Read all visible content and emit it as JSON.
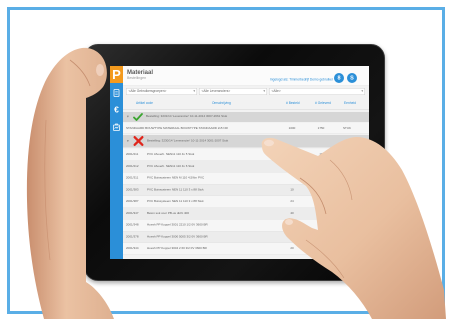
{
  "window": {
    "logo": "P",
    "title": "Materiaal",
    "subtitle": "Bestellingen",
    "user_info": "Ingelogd als: Timmerbedrijf Demo gebruiker",
    "header_buttons": [
      {
        "label": "8",
        "icon": "user-icon"
      },
      {
        "label": "S",
        "icon": "settings-icon"
      }
    ]
  },
  "sidebar": {
    "items": [
      {
        "icon": "document-icon"
      },
      {
        "icon": "euro-icon",
        "glyph": "€"
      },
      {
        "icon": "clipboard-chart-icon"
      }
    ]
  },
  "filters": [
    {
      "value": "<Alle Gebruikersgroepen>",
      "caret": "▾"
    },
    {
      "value": "<Alle Leveranciers>",
      "caret": "▾"
    },
    {
      "value": "<Alle>",
      "caret": "▾"
    }
  ],
  "table": {
    "columns": {
      "code": "Artikel code",
      "description": "Omschrijving",
      "ordered": "# Besteld",
      "delivered": "# Geleverd",
      "unit": "Eenheid"
    },
    "groups": [
      {
        "expander": "▾",
        "status_icon": "check-icon",
        "label": "Bestelling: 3231/14 'Leverancier' 10-11-2014 3007-2661 Stuk",
        "rows": [
          {
            "text": "STANDAARD BOUWTYPE MATERIAAL BOUWTYPE STANDAARD 2x5 NR",
            "ordered": "1000",
            "delivered": "1750",
            "unit": "STUK"
          }
        ]
      },
      {
        "expander": "▾",
        "status_icon": "cross-icon",
        "label": "Bestelling: 3230/14 'Leverancier' 10-11-2014 3001-2007 Stuk",
        "rows": [
          {
            "code": "2001/211",
            "description": "PVC Afvoerb. NEN11 110 4x 5 Stuk",
            "ordered": "",
            "delivered": "10"
          },
          {
            "code": "2001/212",
            "description": "PVC Afvoerb. NEN11 110 4x 6 Stuk",
            "ordered": "",
            "delivered": "24"
          },
          {
            "code": "2001/311",
            "description": "PVC Buissysteem NEN M 110 4,5/6m PVC",
            "ordered": "",
            "delivered": ""
          },
          {
            "code": "2001/383",
            "description": "PVC Buissysteem NEN 11 110 3 x 88 Stuk",
            "ordered": "10",
            "delivered": ""
          },
          {
            "code": "2001/387",
            "description": "PVC Buissysteem NEN 11 110 3 x 88 Stuk",
            "ordered": "24",
            "delivered": ""
          },
          {
            "code": "2001/347",
            "description": "Beton sok voor PB-us dicht 400",
            "ordered": "40",
            "delivered": ""
          },
          {
            "code": "2001/348",
            "description": "Hoesh PP Koppel 3001 2210 1/2 0V 3600 BR",
            "ordered": "24",
            "delivered": ""
          },
          {
            "code": "2001/378",
            "description": "Hoesh PP Koppel 3000 5005 3/2 0V 3600 BR",
            "ordered": "40",
            "delivered": ""
          },
          {
            "code": "2001/344",
            "description": "Hoesh PP Koppel 3004 2 60 3/2 0V 3600 BR",
            "ordered": "20",
            "delivered": ""
          }
        ]
      }
    ]
  },
  "colors": {
    "accent": "#2b8fd8",
    "logo": "#f39a1e",
    "ok": "#3aa52f",
    "error": "#e0261c",
    "frame": "#5aaee6"
  }
}
